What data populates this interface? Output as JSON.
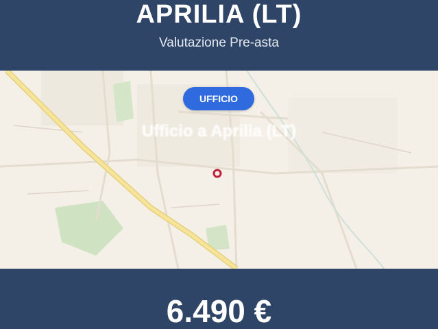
{
  "header": {
    "title": "APRILIA (LT)",
    "subtitle": "Valutazione Pre-asta"
  },
  "map": {
    "badge_label": "UFFICIO",
    "caption": "Ufficio a Aprilia (LT)",
    "marker_icon": "location-ring-icon",
    "colors": {
      "background": "#f4f0e8",
      "main_road": "#f0d77a",
      "green_area": "#cfe2c2",
      "minor_roads": "#e6e0d4",
      "marker": "#c0203a"
    }
  },
  "footer": {
    "price": "6.490 €"
  },
  "colors": {
    "banner": "#2f4568",
    "badge": "#2f6bde"
  }
}
